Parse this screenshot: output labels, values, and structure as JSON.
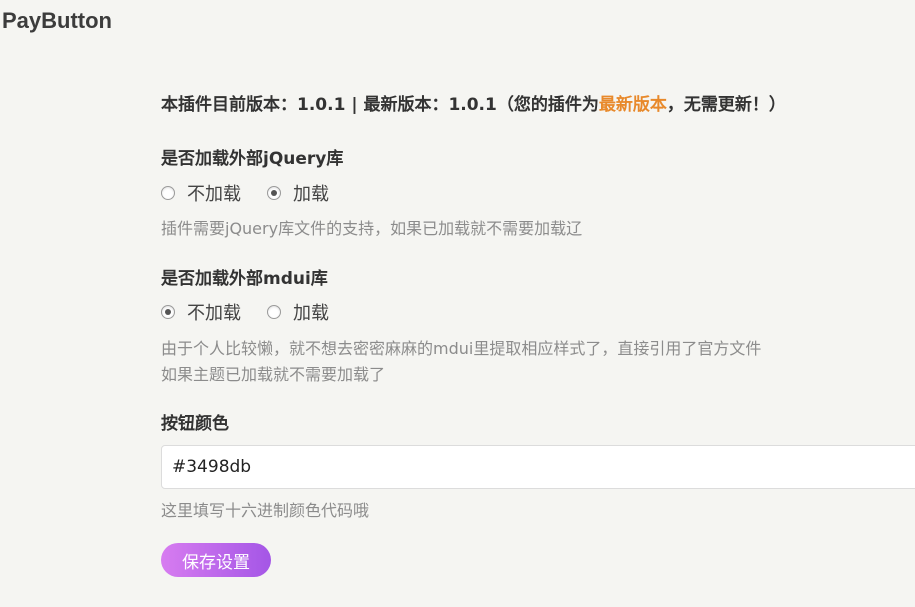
{
  "page": {
    "title": "PayButton"
  },
  "version_notice": {
    "prefix": "本插件目前版本：1.0.1 | 最新版本：1.0.1（您的插件为",
    "highlight": "最新版本",
    "suffix": "，无需更新！）",
    "highlight_color": "#e8892b"
  },
  "jquery": {
    "title": "是否加载外部jQuery库",
    "options": [
      {
        "label": "不加载",
        "checked": false
      },
      {
        "label": "加载",
        "checked": true
      }
    ],
    "description": "插件需要jQuery库文件的支持，如果已加载就不需要加载辽"
  },
  "mdui": {
    "title": "是否加载外部mdui库",
    "options": [
      {
        "label": "不加载",
        "checked": true
      },
      {
        "label": "加载",
        "checked": false
      }
    ],
    "description_line1": "由于个人比较懒，就不想去密密麻麻的mdui里提取相应样式了，直接引用了官方文件",
    "description_line2": "如果主题已加载就不需要加载了"
  },
  "button_color": {
    "title": "按钮颜色",
    "value": "#3498db",
    "description": "这里填写十六进制颜色代码哦"
  },
  "actions": {
    "save_label": "保存设置"
  },
  "colors": {
    "button_gradient_start": "#d77cf0",
    "button_gradient_end": "#a456e6"
  }
}
